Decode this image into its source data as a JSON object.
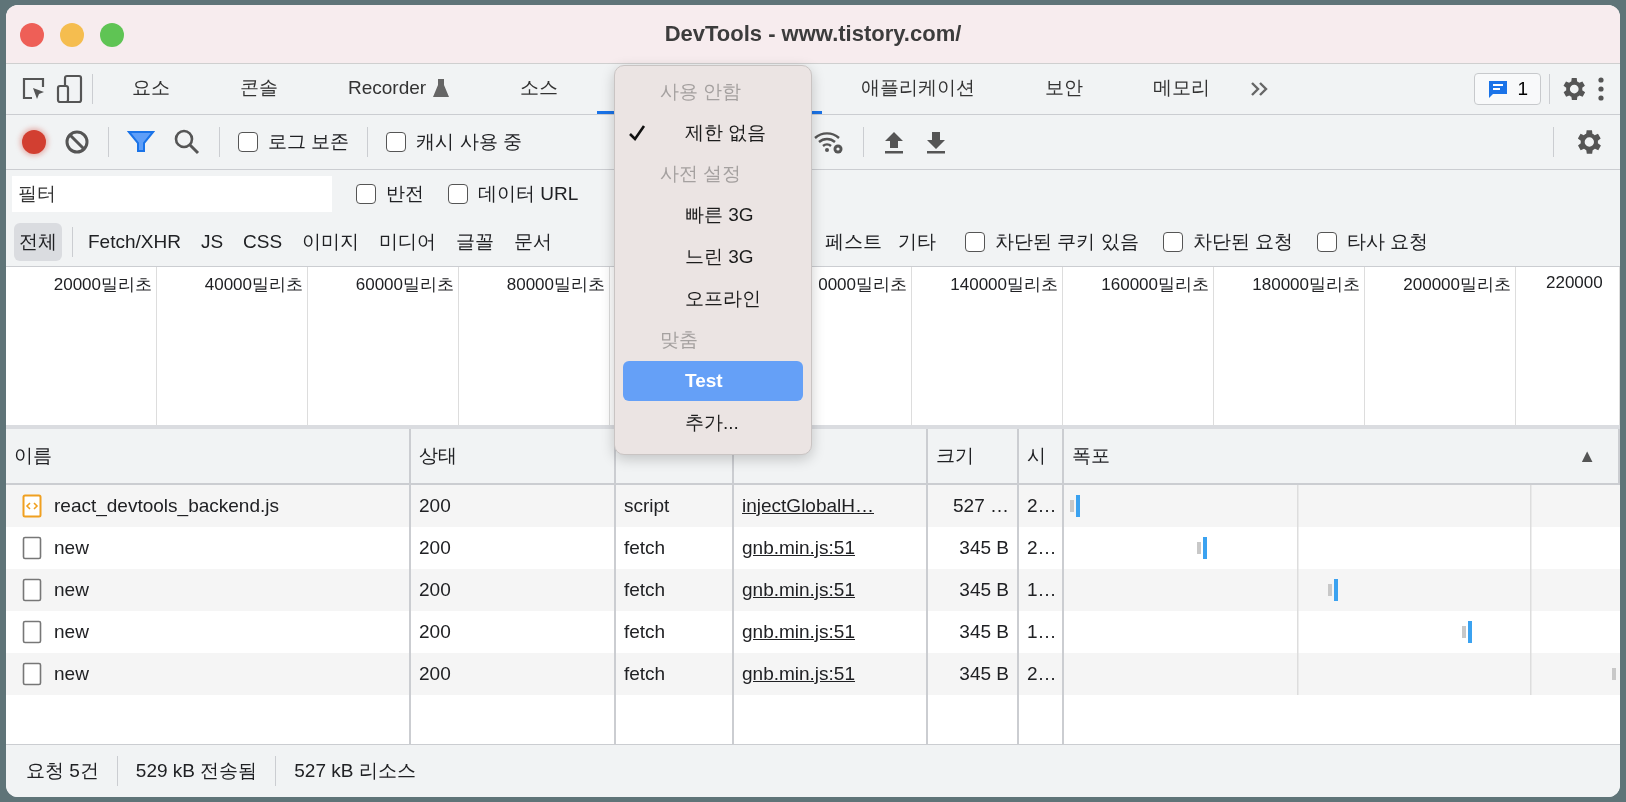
{
  "window": {
    "title": "DevTools - www.tistory.com/"
  },
  "tabs": [
    {
      "label": "요소",
      "selected": false
    },
    {
      "label": "콘솔",
      "selected": false
    },
    {
      "label": "Recorder",
      "selected": false,
      "experimental": true
    },
    {
      "label": "소스",
      "selected": false
    },
    {
      "selected": true
    },
    {
      "label": "애플리케이션",
      "selected": false
    },
    {
      "label": "보안",
      "selected": false
    },
    {
      "label": "메모리",
      "selected": false
    }
  ],
  "issues": {
    "count": "1"
  },
  "toolbar": {
    "recording": true,
    "filter_on": true,
    "checkboxes": [
      {
        "label": "로그 보존",
        "checked": false
      },
      {
        "label": "캐시 사용 중",
        "checked": false
      }
    ]
  },
  "filter": {
    "placeholder": "필터",
    "checkboxes": [
      {
        "label": "반전",
        "checked": false
      },
      {
        "label": "데이터 URL",
        "checked": false
      }
    ]
  },
  "types": [
    {
      "label": "전체",
      "selected": true
    },
    {
      "label": "Fetch/XHR",
      "selected": false
    },
    {
      "label": "JS",
      "selected": false
    },
    {
      "label": "CSS",
      "selected": false
    },
    {
      "label": "이미지",
      "selected": false
    },
    {
      "label": "미디어",
      "selected": false
    },
    {
      "label": "글꼴",
      "selected": false
    },
    {
      "label": "문서",
      "selected": false
    },
    {
      "label": "페스트",
      "selected": false
    },
    {
      "label": "기타",
      "selected": false
    }
  ],
  "type_checkboxes": [
    {
      "label": "차단된 쿠키 있음",
      "checked": false
    },
    {
      "label": "차단된 요청",
      "checked": false
    },
    {
      "label": "타사 요청",
      "checked": false
    }
  ],
  "overview": {
    "ticks": [
      {
        "label": "20000밀리초"
      },
      {
        "label": "40000밀리초"
      },
      {
        "label": "60000밀리초"
      },
      {
        "label": "80000밀리초"
      },
      {
        "label": "0000밀리초"
      },
      {
        "label": "140000밀리초"
      },
      {
        "label": "160000밀리초"
      },
      {
        "label": "180000밀리초"
      },
      {
        "label": "200000밀리초"
      },
      {
        "label": "220000"
      }
    ]
  },
  "table": {
    "columns": [
      {
        "label": "이름"
      },
      {
        "label": "상태"
      },
      {},
      {},
      {
        "label": "크기"
      },
      {
        "label": "시"
      },
      {
        "label": "폭포",
        "sort": "▲"
      }
    ],
    "rows": [
      {
        "kind": "script",
        "name": "react_devtools_backend.js",
        "status": "200",
        "type": "script",
        "initiator": "injectGlobalH…",
        "size": "527 …",
        "time": "2…"
      },
      {
        "kind": "blank",
        "name": "new",
        "status": "200",
        "type": "fetch",
        "initiator": "gnb.min.js:51",
        "size": "345 B",
        "time": "2…"
      },
      {
        "kind": "blank",
        "name": "new",
        "status": "200",
        "type": "fetch",
        "initiator": "gnb.min.js:51",
        "size": "345 B",
        "time": "1…"
      },
      {
        "kind": "blank",
        "name": "new",
        "status": "200",
        "type": "fetch",
        "initiator": "gnb.min.js:51",
        "size": "345 B",
        "time": "1…"
      },
      {
        "kind": "blank",
        "name": "new",
        "status": "200",
        "type": "fetch",
        "initiator": "gnb.min.js:51",
        "size": "345 B",
        "time": "2…"
      }
    ]
  },
  "status_bar": [
    "요청 5건",
    "529 kB 전송됨",
    "527 kB 리소스"
  ],
  "menu": [
    {
      "kind": "header",
      "label": "사용 안함"
    },
    {
      "kind": "item",
      "label": "제한 없음",
      "checked": true,
      "selected": false
    },
    {
      "kind": "header",
      "label": "사전 설정"
    },
    {
      "kind": "item",
      "label": "빠른 3G",
      "checked": false,
      "selected": false
    },
    {
      "kind": "item",
      "label": "느린 3G",
      "checked": false,
      "selected": false
    },
    {
      "kind": "item",
      "label": "오프라인",
      "checked": false,
      "selected": false
    },
    {
      "kind": "header",
      "label": "맞춤"
    },
    {
      "kind": "item",
      "label": "Test",
      "checked": false,
      "selected": true
    },
    {
      "kind": "item",
      "label": "추가...",
      "checked": false,
      "selected": false
    }
  ]
}
